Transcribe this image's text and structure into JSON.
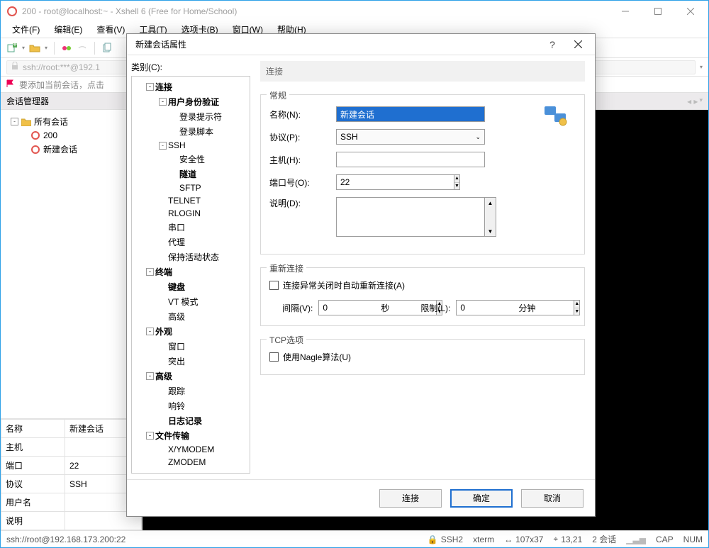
{
  "window": {
    "title": "200 - root@localhost:~ - Xshell 6 (Free for Home/School)"
  },
  "menubar": [
    "文件(F)",
    "编辑(E)",
    "查看(V)",
    "工具(T)",
    "选项卡(B)",
    "窗口(W)",
    "帮助(H)"
  ],
  "address": "ssh://root:***@192.1",
  "tab_hint": "要添加当前会话，点击",
  "panel_title": "会话管理器",
  "session_tree": {
    "root": "所有会话",
    "items": [
      "200",
      "新建会话"
    ]
  },
  "props": {
    "rows": [
      {
        "k": "名称",
        "v": "新建会话"
      },
      {
        "k": "主机",
        "v": ""
      },
      {
        "k": "端口",
        "v": "22"
      },
      {
        "k": "协议",
        "v": "SSH"
      },
      {
        "k": "用户名",
        "v": ""
      },
      {
        "k": "说明",
        "v": ""
      }
    ]
  },
  "status": {
    "path": "ssh://root@192.168.173.200:22",
    "proto": "SSH2",
    "term": "xterm",
    "size": "107x37",
    "pos": "13,21",
    "sess": "2 会话",
    "cap": "CAP",
    "num": "NUM"
  },
  "dialog": {
    "title": "新建会话属性",
    "category_label": "类别(C):",
    "tree": [
      {
        "t": "连接",
        "d": 1,
        "exp": "-",
        "b": true
      },
      {
        "t": "用户身份验证",
        "d": 2,
        "exp": "-",
        "b": true
      },
      {
        "t": "登录提示符",
        "d": 3
      },
      {
        "t": "登录脚本",
        "d": 3
      },
      {
        "t": "SSH",
        "d": 2,
        "exp": "-"
      },
      {
        "t": "安全性",
        "d": 3
      },
      {
        "t": "隧道",
        "d": 3,
        "b": true
      },
      {
        "t": "SFTP",
        "d": 3
      },
      {
        "t": "TELNET",
        "d": 2
      },
      {
        "t": "RLOGIN",
        "d": 2
      },
      {
        "t": "串口",
        "d": 2
      },
      {
        "t": "代理",
        "d": 2
      },
      {
        "t": "保持活动状态",
        "d": 2
      },
      {
        "t": "终端",
        "d": 1,
        "exp": "-",
        "b": true
      },
      {
        "t": "键盘",
        "d": 2,
        "b": true
      },
      {
        "t": "VT 模式",
        "d": 2
      },
      {
        "t": "高级",
        "d": 2
      },
      {
        "t": "外观",
        "d": 1,
        "exp": "-",
        "b": true
      },
      {
        "t": "窗口",
        "d": 2
      },
      {
        "t": "突出",
        "d": 2
      },
      {
        "t": "高级",
        "d": 1,
        "exp": "-",
        "b": true
      },
      {
        "t": "跟踪",
        "d": 2
      },
      {
        "t": "响铃",
        "d": 2
      },
      {
        "t": "日志记录",
        "d": 2,
        "b": true
      },
      {
        "t": "文件传输",
        "d": 1,
        "exp": "-",
        "b": true
      },
      {
        "t": "X/YMODEM",
        "d": 2
      },
      {
        "t": "ZMODEM",
        "d": 2
      }
    ],
    "header": "连接",
    "groups": {
      "general": {
        "legend": "常规",
        "name_label": "名称(N):",
        "name_value": "新建会话",
        "proto_label": "协议(P):",
        "proto_value": "SSH",
        "host_label": "主机(H):",
        "host_value": "",
        "port_label": "端口号(O):",
        "port_value": "22",
        "desc_label": "说明(D):"
      },
      "reconnect": {
        "legend": "重新连接",
        "auto_label": "连接异常关闭时自动重新连接(A)",
        "interval_label": "间隔(V):",
        "interval_value": "0",
        "interval_unit": "秒",
        "limit_label": "限制(L):",
        "limit_value": "0",
        "limit_unit": "分钟"
      },
      "tcp": {
        "legend": "TCP选项",
        "nagle_label": "使用Nagle算法(U)"
      }
    },
    "buttons": {
      "connect": "连接",
      "ok": "确定",
      "cancel": "取消"
    }
  }
}
